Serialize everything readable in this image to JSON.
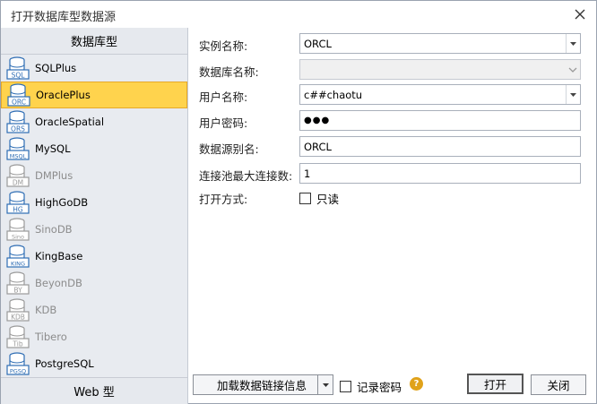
{
  "window": {
    "title": "打开数据库型数据源",
    "close_icon": "close-icon"
  },
  "left_panel": {
    "header": "数据库型",
    "items": [
      {
        "label": "SQLPlus",
        "icon": "SQL",
        "enabled": true,
        "selected": false
      },
      {
        "label": "OraclePlus",
        "icon": "ORC",
        "enabled": true,
        "selected": true
      },
      {
        "label": "OracleSpatial",
        "icon": "ORS",
        "enabled": true,
        "selected": false
      },
      {
        "label": "MySQL",
        "icon": "MSQL",
        "enabled": true,
        "selected": false
      },
      {
        "label": "DMPlus",
        "icon": "DM",
        "enabled": false,
        "selected": false
      },
      {
        "label": "HighGoDB",
        "icon": "HG",
        "enabled": true,
        "selected": false
      },
      {
        "label": "SinoDB",
        "icon": "Sino",
        "enabled": false,
        "selected": false
      },
      {
        "label": "KingBase",
        "icon": "KING",
        "enabled": true,
        "selected": false
      },
      {
        "label": "BeyonDB",
        "icon": "BY",
        "enabled": false,
        "selected": false
      },
      {
        "label": "KDB",
        "icon": "KDB",
        "enabled": false,
        "selected": false
      },
      {
        "label": "Tibero",
        "icon": "Tib",
        "enabled": false,
        "selected": false
      },
      {
        "label": "PostgreSQL",
        "icon": "PGSQ",
        "enabled": true,
        "selected": false
      }
    ],
    "footer": "Web 型"
  },
  "form": {
    "instance": {
      "label": "实例名称:",
      "value": "ORCL"
    },
    "database": {
      "label": "数据库名称:",
      "value": ""
    },
    "username": {
      "label": "用户名称:",
      "value": "c##chaotu"
    },
    "password": {
      "label": "用户密码:",
      "value": "●●●"
    },
    "alias": {
      "label": "数据源别名:",
      "value": "ORCL"
    },
    "pool": {
      "label": "连接池最大连接数:",
      "value": "1"
    },
    "open_mode": {
      "label": "打开方式:",
      "readonly_label": "只读",
      "readonly_checked": false
    }
  },
  "bottom": {
    "load_button": "加载数据链接信息",
    "remember_label": "记录密码",
    "remember_checked": false,
    "help_icon": "?",
    "open_button": "打开",
    "close_button": "关闭"
  },
  "colors": {
    "selected_bg": "#ffd34d",
    "db_icon_blue": "#2e6db4",
    "db_icon_gray": "#9a9a9a",
    "help_icon": "#e0a21a"
  }
}
